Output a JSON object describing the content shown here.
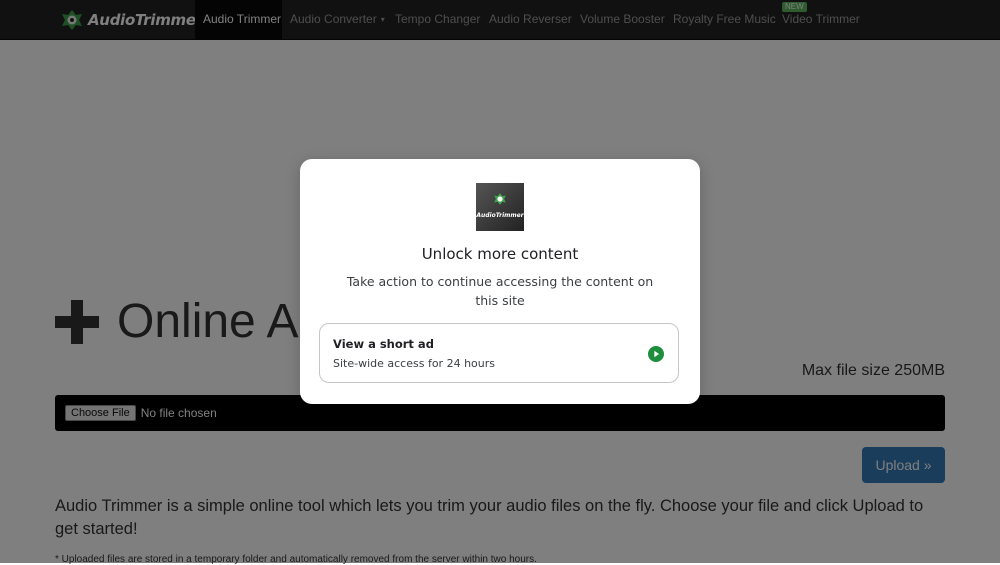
{
  "nav": {
    "brand": "AudioTrimmer",
    "items": [
      "Audio Trimmer",
      "Audio Converter",
      "Tempo Changer",
      "Audio Reverser",
      "Volume Booster",
      "Royalty Free Music",
      "Video Trimmer"
    ],
    "new_badge": "NEW",
    "dropdown_caret": "▾"
  },
  "main": {
    "title": "Online A",
    "max_size": "Max file size 250MB",
    "choose_file": "Choose File",
    "no_file": "No file chosen",
    "upload": "Upload »",
    "description": "Audio Trimmer is a simple online tool which lets you trim your audio files on the fly. Choose your file and click Upload to get started!",
    "footnote": "* Uploaded files are stored in a temporary folder and automatically removed from the server within two hours."
  },
  "modal": {
    "logo_text": "AudioTrimmer",
    "title": "Unlock more content",
    "subtitle": "Take action to continue accessing the content on this site",
    "option_title": "View a short ad",
    "option_desc": "Site-wide access for 24 hours"
  },
  "colors": {
    "navbar": "#222222",
    "overlay": "rgba(0,0,0,0.5)",
    "primary_button": "#337ab7",
    "badge_new": "#5cb85c",
    "ad_arrow": "#1e8e3e"
  }
}
